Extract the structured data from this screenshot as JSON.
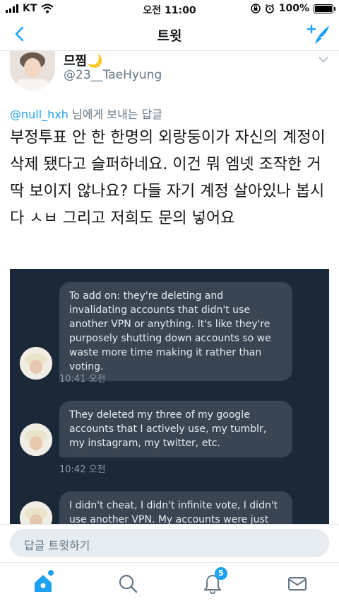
{
  "status_bar": {
    "carrier": "KT",
    "time": "오전 11:00",
    "battery": "100%",
    "battery_level": 1.0
  },
  "nav": {
    "title": "트윗"
  },
  "tweet": {
    "author_name": "므찜🌙",
    "author_handle": "@23__TaeHyung",
    "reply_mention": "@null_hxh",
    "reply_suffix": " 님에게 보내는 답글",
    "text": "부정투표 안 한 한명의 외랑둥이가 자신의 계정이 삭제 됐다고 슬퍼하네요. 이건 뭐 엠넷 조작한 거 딱 보이지 않나요? 다들 자기 계정 살아있나 봅시다 ㅅㅂ 그리고 저희도 문의 넣어요"
  },
  "media": {
    "messages": [
      {
        "text": "To add on: they're deleting and invalidating accounts that didn't use another VPN or anything. It's like they're purposely shutting down accounts so we waste more time making it rather than voting.",
        "time": "10:41 오전"
      },
      {
        "text": "They deleted my three of my google accounts that I actively use, my tumblr, my instagram, my twitter, etc.",
        "time": "10:42 오전"
      },
      {
        "text": "I didn't cheat, I didn't infinite vote, I didn't use another VPN. My accounts were just deleted",
        "time": ""
      }
    ]
  },
  "reply_bar": {
    "placeholder": "답글 트윗하기"
  },
  "tabbar": {
    "notifications_count": "5"
  },
  "colors": {
    "accent": "#1da1f2",
    "media_bg": "#1b2838",
    "bubble": "#3a4553"
  }
}
